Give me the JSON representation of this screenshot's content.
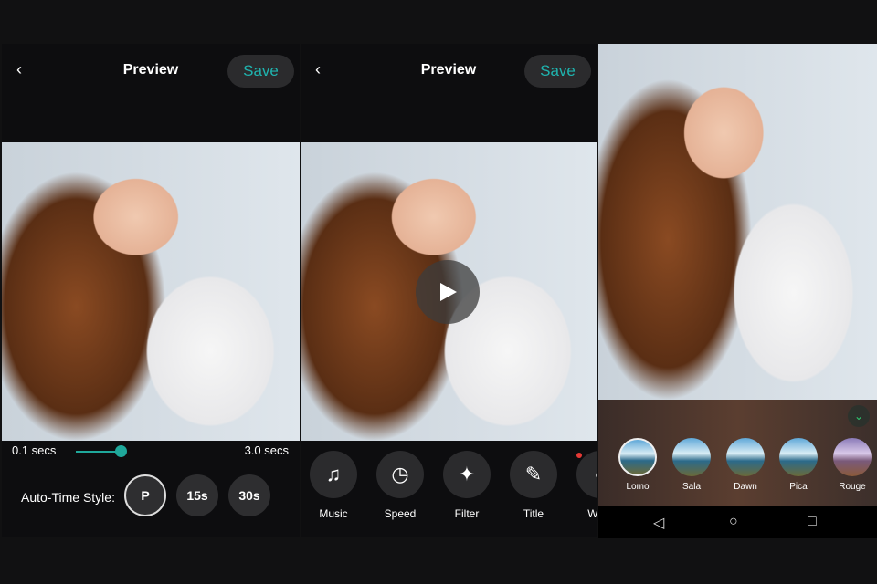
{
  "panel1": {
    "back_icon": "chevron-left-icon",
    "title": "Preview",
    "save_label": "Save",
    "slider": {
      "min_label": "0.1 secs",
      "max_label": "3.0 secs",
      "value_fraction": 0.17
    },
    "auto_time": {
      "label": "Auto-Time Style:",
      "options": [
        "P",
        "15s",
        "30s"
      ],
      "selected": "P"
    }
  },
  "panel2": {
    "back_icon": "chevron-left-icon",
    "title": "Preview",
    "save_label": "Save",
    "play_icon": "play-icon",
    "tools": [
      {
        "label": "Music",
        "icon": "music-note-icon"
      },
      {
        "label": "Speed",
        "icon": "clock-icon"
      },
      {
        "label": "Filter",
        "icon": "magic-wand-icon"
      },
      {
        "label": "Title",
        "icon": "pencil-icon"
      },
      {
        "label": "Wate",
        "icon": "watermark-icon"
      }
    ]
  },
  "panel3": {
    "collapse_icon": "chevron-down-icon",
    "filters": [
      "Lomo",
      "Sala",
      "Dawn",
      "Pica",
      "Rouge"
    ],
    "selected_filter": "Lomo",
    "nav": [
      "back-triangle-icon",
      "home-circle-icon",
      "recents-square-icon"
    ]
  },
  "colors": {
    "accent": "#1fb3ae",
    "background": "#0d0d0f",
    "notification_dot": "#e53935"
  }
}
